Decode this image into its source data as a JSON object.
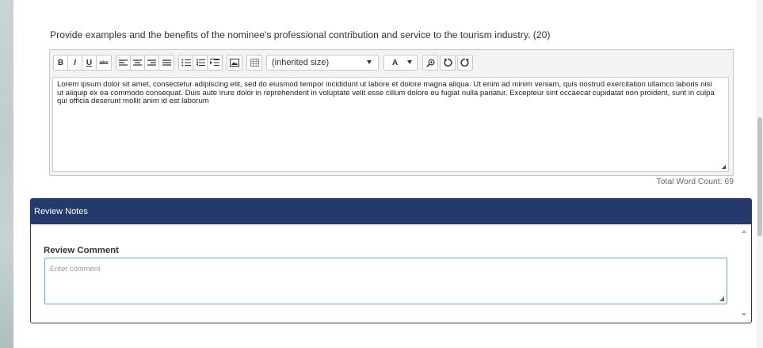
{
  "question": {
    "text": "Provide examples and the benefits of the nominee's professional contribution and service to the tourism industry. (20)"
  },
  "editor": {
    "toolbar": {
      "bold": "B",
      "italic": "I",
      "underline": "U",
      "strikethrough": "abc",
      "font_size": "(inherited size)",
      "font_color": "A"
    },
    "content": "Lorem ipsum dolor sit amet, consectetur adipiscing elit, sed do eiusmod tempor incididunt ut labore et dolore magna aliqua. Ut enim ad minim veniam, quis nostrud exercitation ullamco laboris nisi ut aliquip ex ea commodo consequat. Duis aute irure dolor in reprehenderit in voluptate velit esse cillum dolore eu fugiat nulla pariatur. Excepteur sint occaecat cupidatat non proident, sunt in culpa qui officia deserunt mollit anim id est laborum",
    "word_count": "Total Word Count: 69"
  },
  "review_panel": {
    "header": "Review Notes",
    "comment_label": "Review Comment",
    "comment_placeholder": "Enter comment",
    "comment_value": ""
  },
  "colors": {
    "panel_header": "#24396c",
    "input_focus_border": "#64a6dc"
  }
}
